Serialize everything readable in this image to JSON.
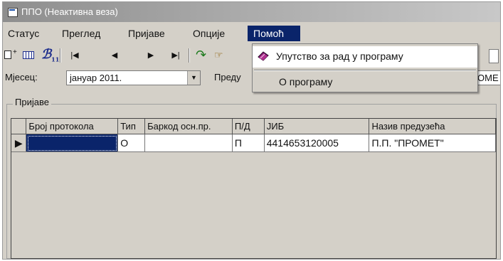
{
  "window": {
    "title": "ППО (Неактивна веза)"
  },
  "menubar": {
    "items": [
      "Статус",
      "Преглед",
      "Пријаве",
      "Опције",
      "Помоћ"
    ],
    "active_index": 4
  },
  "help_menu": {
    "items": [
      "Упутство за рад у програму",
      "О програму"
    ]
  },
  "toolbar": {
    "nav_icons": [
      "first-record-icon",
      "previous-record-icon",
      "next-record-icon",
      "last-record-icon"
    ]
  },
  "filters": {
    "month_label": "Мјесец:",
    "month_value": "јануар 2011.",
    "company_label": "Преду",
    "company_value": "ОМЕ"
  },
  "group": {
    "title": "Пријаве"
  },
  "grid": {
    "columns": [
      "Број протокола",
      "Тип",
      "Баркод осн.пр.",
      "П/Д",
      "ЈИБ",
      "Назив предузећа"
    ],
    "rows": [
      {
        "protocol_no": "",
        "type": "О",
        "barcode": "",
        "pd": "П",
        "jib": "4414653120005",
        "company": "П.П. \"ПРОМЕТ\""
      }
    ]
  },
  "colors": {
    "menu_highlight": "#0a246a",
    "window_face": "#d4d0c8"
  }
}
